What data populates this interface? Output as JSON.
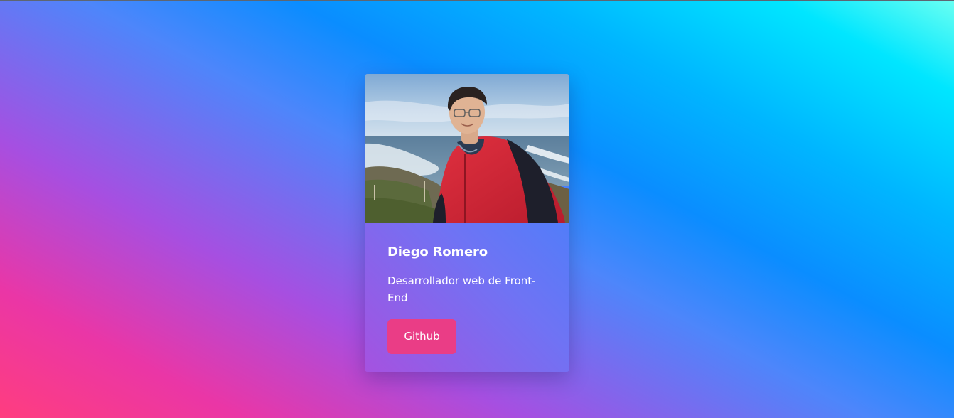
{
  "profile": {
    "name": "Diego Romero",
    "role": "Desarrollador web de Front-End",
    "button_label": "Github"
  },
  "colors": {
    "button": "#ea3d86",
    "card_start": "#a552e0",
    "card_end": "#2f89ff"
  },
  "icons": {
    "photo": "profile-photo"
  }
}
